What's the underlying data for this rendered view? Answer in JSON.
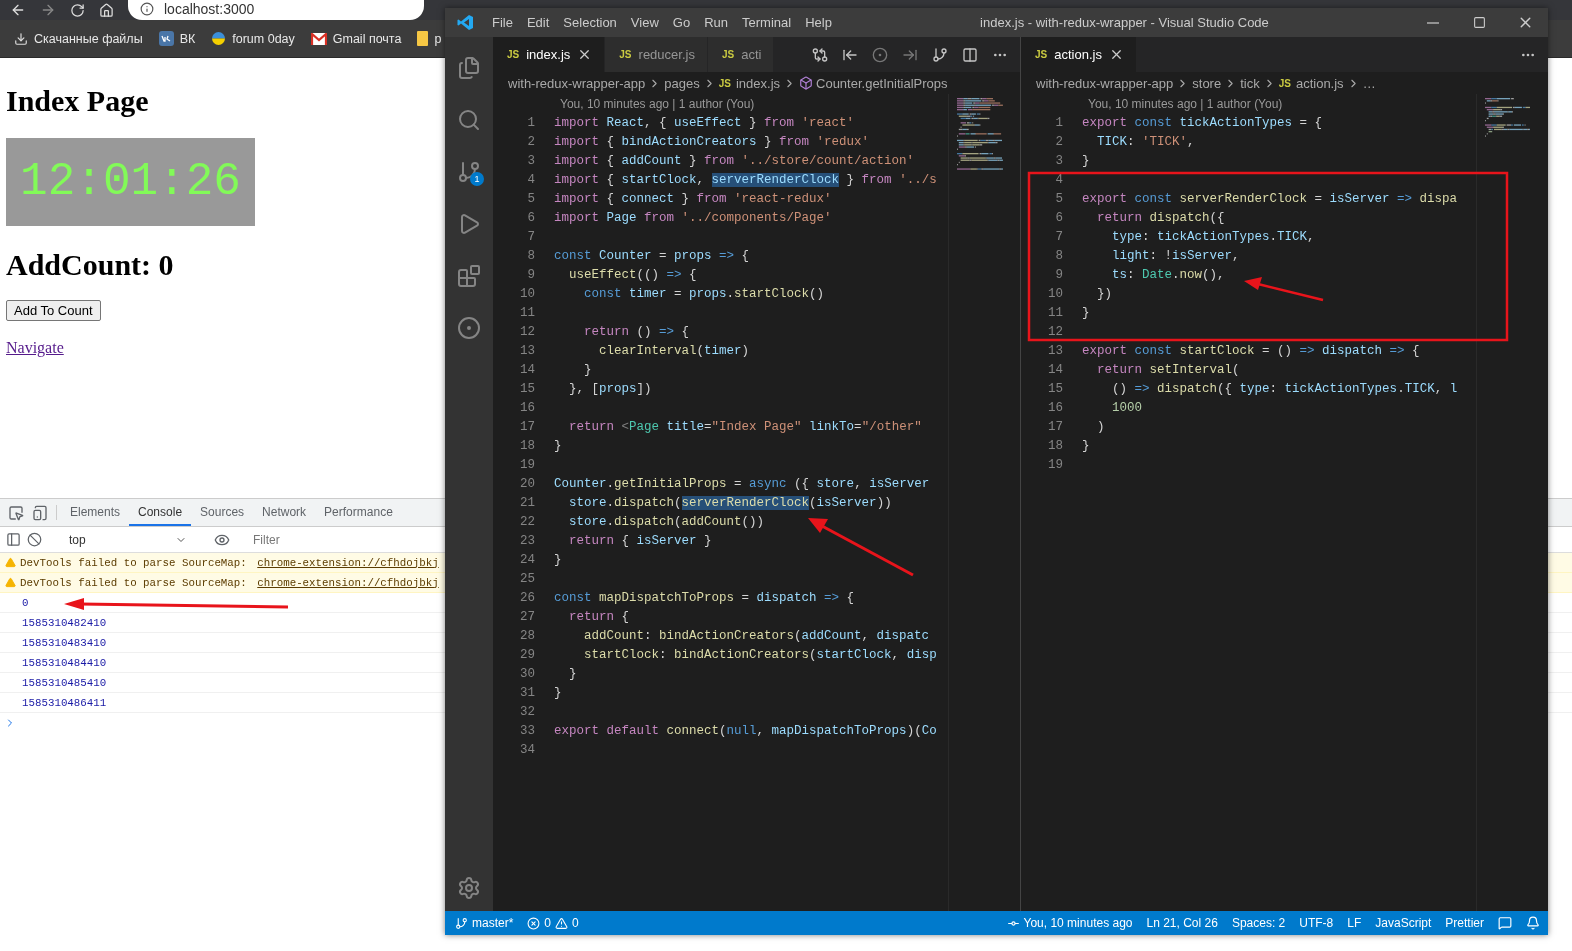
{
  "browser": {
    "address": "localhost:3000",
    "bookmarks": [
      {
        "kind": "download",
        "label": "Скачанные файлы"
      },
      {
        "kind": "vk",
        "label": "ВК"
      },
      {
        "kind": "globe",
        "label": "forum 0day"
      },
      {
        "kind": "mail",
        "label": "Gmail почта"
      },
      {
        "kind": "folder",
        "label": "p"
      }
    ]
  },
  "page": {
    "heading": "Index Page",
    "clock": "12:01:26",
    "count_heading": "AddCount: 0",
    "button": "Add To Count",
    "link": "Navigate"
  },
  "devtools": {
    "tabs": [
      {
        "label": "Elements",
        "selected": false
      },
      {
        "label": "Console",
        "selected": true
      },
      {
        "label": "Sources",
        "selected": false
      },
      {
        "label": "Network",
        "selected": false
      },
      {
        "label": "Performance",
        "selected": false
      }
    ],
    "context": "top",
    "filter_placeholder": "Filter",
    "messages": [
      {
        "kind": "warning",
        "text": "DevTools failed to parse SourceMap: ",
        "link": "chrome-extension://cfhdojbkj"
      },
      {
        "kind": "warning",
        "text": "DevTools failed to parse SourceMap: ",
        "link": "chrome-extension://cfhdojbkj"
      },
      {
        "kind": "log",
        "text": "0"
      },
      {
        "kind": "log",
        "text": "1585310482410"
      },
      {
        "kind": "log",
        "text": "1585310483410"
      },
      {
        "kind": "log",
        "text": "1585310484410"
      },
      {
        "kind": "log",
        "text": "1585310485410"
      },
      {
        "kind": "log",
        "text": "1585310486411"
      }
    ]
  },
  "vscode": {
    "menu": [
      "File",
      "Edit",
      "Selection",
      "View",
      "Go",
      "Run",
      "Terminal",
      "Help"
    ],
    "title": "index.js - with-redux-wrapper - Visual Studio Code",
    "scm_badge": "1",
    "groups": [
      {
        "tabs": [
          {
            "badge": "JS",
            "label": "index.js",
            "selected": true
          },
          {
            "badge": "JS",
            "label": "reducer.js",
            "selected": false
          },
          {
            "badge": "JS",
            "label": "acti",
            "selected": false
          }
        ],
        "breadcrumbs": [
          {
            "kind": "folder",
            "label": "with-redux-wrapper-app"
          },
          {
            "kind": "folder",
            "label": "pages"
          },
          {
            "kind": "file",
            "badge": "JS",
            "label": "index.js"
          },
          {
            "kind": "symbol",
            "label": "Counter.getInitialProps"
          }
        ],
        "blame": "You, 10 minutes ago | 1 author (You)",
        "lines": [
          {
            "n": "1",
            "t": [
              {
                "kind": "control",
                "text": "import "
              },
              {
                "kind": "variable",
                "text": "React"
              },
              {
                "kind": "plain",
                "text": ", { "
              },
              {
                "kind": "variable",
                "text": "useEffect"
              },
              {
                "kind": "plain",
                "text": " } "
              },
              {
                "kind": "control",
                "text": "from "
              },
              {
                "kind": "string",
                "text": "'react'"
              }
            ]
          },
          {
            "n": "2",
            "t": [
              {
                "kind": "control",
                "text": "import "
              },
              {
                "kind": "plain",
                "text": "{ "
              },
              {
                "kind": "variable",
                "text": "bindActionCreators"
              },
              {
                "kind": "plain",
                "text": " } "
              },
              {
                "kind": "control",
                "text": "from "
              },
              {
                "kind": "string",
                "text": "'redux'"
              }
            ]
          },
          {
            "n": "3",
            "t": [
              {
                "kind": "control",
                "text": "import "
              },
              {
                "kind": "plain",
                "text": "{ "
              },
              {
                "kind": "variable",
                "text": "addCount"
              },
              {
                "kind": "plain",
                "text": " } "
              },
              {
                "kind": "control",
                "text": "from "
              },
              {
                "kind": "string",
                "text": "'../store/count/action'"
              }
            ]
          },
          {
            "n": "4",
            "t": [
              {
                "kind": "control",
                "text": "import "
              },
              {
                "kind": "plain",
                "text": "{ "
              },
              {
                "kind": "variable",
                "text": "startClock"
              },
              {
                "kind": "plain",
                "text": ", "
              },
              {
                "kind": "variable",
                "text": "serverRenderClock",
                "highlighted": true
              },
              {
                "kind": "plain",
                "text": " } "
              },
              {
                "kind": "control",
                "text": "from "
              },
              {
                "kind": "string",
                "text": "'../s"
              }
            ]
          },
          {
            "n": "5",
            "t": [
              {
                "kind": "control",
                "text": "import "
              },
              {
                "kind": "plain",
                "text": "{ "
              },
              {
                "kind": "variable",
                "text": "connect"
              },
              {
                "kind": "plain",
                "text": " } "
              },
              {
                "kind": "control",
                "text": "from "
              },
              {
                "kind": "string",
                "text": "'react-redux'"
              }
            ]
          },
          {
            "n": "6",
            "t": [
              {
                "kind": "control",
                "text": "import "
              },
              {
                "kind": "variable",
                "text": "Page"
              },
              {
                "kind": "control",
                "text": " from "
              },
              {
                "kind": "string",
                "text": "'../components/Page'"
              }
            ]
          },
          {
            "n": "7"
          },
          {
            "n": "8",
            "t": [
              {
                "kind": "keyword",
                "text": "const "
              },
              {
                "kind": "variable",
                "text": "Counter"
              },
              {
                "kind": "plain",
                "text": " = "
              },
              {
                "kind": "variable",
                "text": "props"
              },
              {
                "kind": "keyword",
                "text": " => "
              },
              {
                "kind": "plain",
                "text": "{"
              }
            ]
          },
          {
            "n": "9",
            "t": [
              {
                "kind": "function",
                "text": "  useEffect"
              },
              {
                "kind": "plain",
                "text": "(() "
              },
              {
                "kind": "keyword",
                "text": "=>"
              },
              {
                "kind": "plain",
                "text": " {"
              }
            ]
          },
          {
            "n": "10",
            "t": [
              {
                "kind": "keyword",
                "text": "    const "
              },
              {
                "kind": "variable",
                "text": "timer"
              },
              {
                "kind": "plain",
                "text": " = "
              },
              {
                "kind": "variable",
                "text": "props"
              },
              {
                "kind": "plain",
                "text": "."
              },
              {
                "kind": "function",
                "text": "startClock"
              },
              {
                "kind": "plain",
                "text": "()"
              }
            ]
          },
          {
            "n": "11"
          },
          {
            "n": "12",
            "t": [
              {
                "kind": "control",
                "text": "    return"
              },
              {
                "kind": "plain",
                "text": " () "
              },
              {
                "kind": "keyword",
                "text": "=>"
              },
              {
                "kind": "plain",
                "text": " {"
              }
            ]
          },
          {
            "n": "13",
            "t": [
              {
                "kind": "function",
                "text": "      clearInterval"
              },
              {
                "kind": "plain",
                "text": "("
              },
              {
                "kind": "variable",
                "text": "timer"
              },
              {
                "kind": "plain",
                "text": ")"
              }
            ]
          },
          {
            "n": "14",
            "t": [
              {
                "kind": "plain",
                "text": "    }"
              }
            ]
          },
          {
            "n": "15",
            "t": [
              {
                "kind": "plain",
                "text": "  }, ["
              },
              {
                "kind": "variable",
                "text": "props"
              },
              {
                "kind": "plain",
                "text": "])"
              }
            ]
          },
          {
            "n": "16"
          },
          {
            "n": "17",
            "t": [
              {
                "kind": "control",
                "text": "  return "
              },
              {
                "kind": "tag",
                "text": "<"
              },
              {
                "kind": "type",
                "text": "Page"
              },
              {
                "kind": "variable",
                "text": " title"
              },
              {
                "kind": "plain",
                "text": "="
              },
              {
                "kind": "string",
                "text": "\"Index Page\""
              },
              {
                "kind": "variable",
                "text": " linkTo"
              },
              {
                "kind": "plain",
                "text": "="
              },
              {
                "kind": "string",
                "text": "\"/other\""
              }
            ]
          },
          {
            "n": "18",
            "t": [
              {
                "kind": "plain",
                "text": "}"
              }
            ]
          },
          {
            "n": "19"
          },
          {
            "n": "20",
            "t": [
              {
                "kind": "variable",
                "text": "Counter"
              },
              {
                "kind": "plain",
                "text": "."
              },
              {
                "kind": "function",
                "text": "getInitialProps"
              },
              {
                "kind": "plain",
                "text": " = "
              },
              {
                "kind": "keyword",
                "text": "async "
              },
              {
                "kind": "plain",
                "text": "({ "
              },
              {
                "kind": "variable",
                "text": "store"
              },
              {
                "kind": "plain",
                "text": ", "
              },
              {
                "kind": "variable",
                "text": "isServer"
              }
            ]
          },
          {
            "n": "21",
            "t": [
              {
                "kind": "variable",
                "text": "  store"
              },
              {
                "kind": "plain",
                "text": "."
              },
              {
                "kind": "function",
                "text": "dispatch"
              },
              {
                "kind": "plain",
                "text": "("
              },
              {
                "kind": "function",
                "text": "serverRenderClock",
                "highlighted": true
              },
              {
                "kind": "plain",
                "text": "("
              },
              {
                "kind": "variable",
                "text": "isServer"
              },
              {
                "kind": "plain",
                "text": "))"
              }
            ]
          },
          {
            "n": "22",
            "t": [
              {
                "kind": "variable",
                "text": "  store"
              },
              {
                "kind": "plain",
                "text": "."
              },
              {
                "kind": "function",
                "text": "dispatch"
              },
              {
                "kind": "plain",
                "text": "("
              },
              {
                "kind": "function",
                "text": "addCount"
              },
              {
                "kind": "plain",
                "text": "())"
              }
            ]
          },
          {
            "n": "23",
            "t": [
              {
                "kind": "control",
                "text": "  return "
              },
              {
                "kind": "plain",
                "text": "{ "
              },
              {
                "kind": "variable",
                "text": "isServer"
              },
              {
                "kind": "plain",
                "text": " }"
              }
            ]
          },
          {
            "n": "24",
            "t": [
              {
                "kind": "plain",
                "text": "}"
              }
            ]
          },
          {
            "n": "25"
          },
          {
            "n": "26",
            "t": [
              {
                "kind": "keyword",
                "text": "const "
              },
              {
                "kind": "function",
                "text": "mapDispatchToProps"
              },
              {
                "kind": "plain",
                "text": " = "
              },
              {
                "kind": "variable",
                "text": "dispatch"
              },
              {
                "kind": "keyword",
                "text": " => "
              },
              {
                "kind": "plain",
                "text": "{"
              }
            ]
          },
          {
            "n": "27",
            "t": [
              {
                "kind": "control",
                "text": "  return "
              },
              {
                "kind": "plain",
                "text": "{"
              }
            ]
          },
          {
            "n": "28",
            "t": [
              {
                "kind": "function",
                "text": "    addCount"
              },
              {
                "kind": "plain",
                "text": ": "
              },
              {
                "kind": "function",
                "text": "bindActionCreators"
              },
              {
                "kind": "plain",
                "text": "("
              },
              {
                "kind": "variable",
                "text": "addCount"
              },
              {
                "kind": "plain",
                "text": ", "
              },
              {
                "kind": "variable",
                "text": "dispatc"
              }
            ]
          },
          {
            "n": "29",
            "t": [
              {
                "kind": "function",
                "text": "    startClock"
              },
              {
                "kind": "plain",
                "text": ": "
              },
              {
                "kind": "function",
                "text": "bindActionCreators"
              },
              {
                "kind": "plain",
                "text": "("
              },
              {
                "kind": "variable",
                "text": "startClock"
              },
              {
                "kind": "plain",
                "text": ", "
              },
              {
                "kind": "variable",
                "text": "disp"
              }
            ]
          },
          {
            "n": "30",
            "t": [
              {
                "kind": "plain",
                "text": "  }"
              }
            ]
          },
          {
            "n": "31",
            "t": [
              {
                "kind": "plain",
                "text": "}"
              }
            ]
          },
          {
            "n": "32"
          },
          {
            "n": "33",
            "t": [
              {
                "kind": "control",
                "text": "export default "
              },
              {
                "kind": "function",
                "text": "connect"
              },
              {
                "kind": "plain",
                "text": "("
              },
              {
                "kind": "keyword",
                "text": "null"
              },
              {
                "kind": "plain",
                "text": ", "
              },
              {
                "kind": "variable",
                "text": "mapDispatchToProps"
              },
              {
                "kind": "plain",
                "text": ")("
              },
              {
                "kind": "variable",
                "text": "Co"
              }
            ]
          },
          {
            "n": "34"
          }
        ]
      },
      {
        "tabs": [
          {
            "badge": "JS",
            "label": "action.js",
            "selected": true
          }
        ],
        "breadcrumbs": [
          {
            "kind": "folder",
            "label": "with-redux-wrapper-app"
          },
          {
            "kind": "folder",
            "label": "store"
          },
          {
            "kind": "folder",
            "label": "tick"
          },
          {
            "kind": "file",
            "badge": "JS",
            "label": "action.js"
          },
          {
            "kind": "folder",
            "label": "…"
          }
        ],
        "blame": "You, 10 minutes ago | 1 author (You)",
        "lines": [
          {
            "n": "1",
            "t": [
              {
                "kind": "control",
                "text": "export "
              },
              {
                "kind": "keyword",
                "text": "const "
              },
              {
                "kind": "variable",
                "text": "tickActionTypes"
              },
              {
                "kind": "plain",
                "text": " = {"
              }
            ]
          },
          {
            "n": "2",
            "t": [
              {
                "kind": "variable",
                "text": "  TICK"
              },
              {
                "kind": "plain",
                "text": ": "
              },
              {
                "kind": "string",
                "text": "'TICK'"
              },
              {
                "kind": "plain",
                "text": ","
              }
            ]
          },
          {
            "n": "3",
            "t": [
              {
                "kind": "plain",
                "text": "}"
              }
            ]
          },
          {
            "n": "4"
          },
          {
            "n": "5",
            "t": [
              {
                "kind": "control",
                "text": "export "
              },
              {
                "kind": "keyword",
                "text": "const "
              },
              {
                "kind": "function",
                "text": "serverRenderClock"
              },
              {
                "kind": "plain",
                "text": " = "
              },
              {
                "kind": "variable",
                "text": "isServer"
              },
              {
                "kind": "keyword",
                "text": " => "
              },
              {
                "kind": "function",
                "text": "dispa"
              }
            ]
          },
          {
            "n": "6",
            "t": [
              {
                "kind": "control",
                "text": "  return "
              },
              {
                "kind": "function",
                "text": "dispatch"
              },
              {
                "kind": "plain",
                "text": "({"
              }
            ]
          },
          {
            "n": "7",
            "t": [
              {
                "kind": "variable",
                "text": "    type"
              },
              {
                "kind": "plain",
                "text": ": "
              },
              {
                "kind": "variable",
                "text": "tickActionTypes"
              },
              {
                "kind": "plain",
                "text": "."
              },
              {
                "kind": "variable",
                "text": "TICK"
              },
              {
                "kind": "plain",
                "text": ","
              }
            ]
          },
          {
            "n": "8",
            "t": [
              {
                "kind": "variable",
                "text": "    light"
              },
              {
                "kind": "plain",
                "text": ": !"
              },
              {
                "kind": "variable",
                "text": "isServer"
              },
              {
                "kind": "plain",
                "text": ","
              }
            ]
          },
          {
            "n": "9",
            "t": [
              {
                "kind": "variable",
                "text": "    ts"
              },
              {
                "kind": "plain",
                "text": ": "
              },
              {
                "kind": "type",
                "text": "Date"
              },
              {
                "kind": "plain",
                "text": "."
              },
              {
                "kind": "function",
                "text": "now"
              },
              {
                "kind": "plain",
                "text": "(),"
              }
            ]
          },
          {
            "n": "10",
            "t": [
              {
                "kind": "plain",
                "text": "  })"
              }
            ]
          },
          {
            "n": "11",
            "t": [
              {
                "kind": "plain",
                "text": "}"
              }
            ]
          },
          {
            "n": "12"
          },
          {
            "n": "13",
            "t": [
              {
                "kind": "control",
                "text": "export "
              },
              {
                "kind": "keyword",
                "text": "const "
              },
              {
                "kind": "function",
                "text": "startClock"
              },
              {
                "kind": "plain",
                "text": " = () "
              },
              {
                "kind": "keyword",
                "text": "=>"
              },
              {
                "kind": "variable",
                "text": " dispatch"
              },
              {
                "kind": "keyword",
                "text": " =>"
              },
              {
                "kind": "plain",
                "text": " {"
              }
            ]
          },
          {
            "n": "14",
            "t": [
              {
                "kind": "control",
                "text": "  return "
              },
              {
                "kind": "function",
                "text": "setInterval"
              },
              {
                "kind": "plain",
                "text": "("
              }
            ]
          },
          {
            "n": "15",
            "t": [
              {
                "kind": "plain",
                "text": "    () "
              },
              {
                "kind": "keyword",
                "text": "=>"
              },
              {
                "kind": "function",
                "text": " dispatch"
              },
              {
                "kind": "plain",
                "text": "({ "
              },
              {
                "kind": "variable",
                "text": "type"
              },
              {
                "kind": "plain",
                "text": ": "
              },
              {
                "kind": "variable",
                "text": "tickActionTypes"
              },
              {
                "kind": "plain",
                "text": "."
              },
              {
                "kind": "variable",
                "text": "TICK"
              },
              {
                "kind": "plain",
                "text": ", "
              },
              {
                "kind": "variable",
                "text": "l"
              }
            ]
          },
          {
            "n": "16",
            "t": [
              {
                "kind": "number",
                "text": "    1000"
              }
            ]
          },
          {
            "n": "17",
            "t": [
              {
                "kind": "plain",
                "text": "  )"
              }
            ]
          },
          {
            "n": "18",
            "t": [
              {
                "kind": "plain",
                "text": "}"
              }
            ]
          },
          {
            "n": "19"
          }
        ]
      }
    ],
    "status_left": {
      "branch": "master*",
      "errors": "0",
      "warnings": "0"
    },
    "status_right": [
      {
        "kind": "blame",
        "label": "You, 10 minutes ago"
      },
      {
        "kind": "text",
        "label": "Ln 21, Col 26"
      },
      {
        "kind": "text",
        "label": "Spaces: 2"
      },
      {
        "kind": "text",
        "label": "UTF-8"
      },
      {
        "kind": "text",
        "label": "LF"
      },
      {
        "kind": "text",
        "label": "JavaScript"
      },
      {
        "kind": "text",
        "label": "Prettier"
      }
    ]
  }
}
